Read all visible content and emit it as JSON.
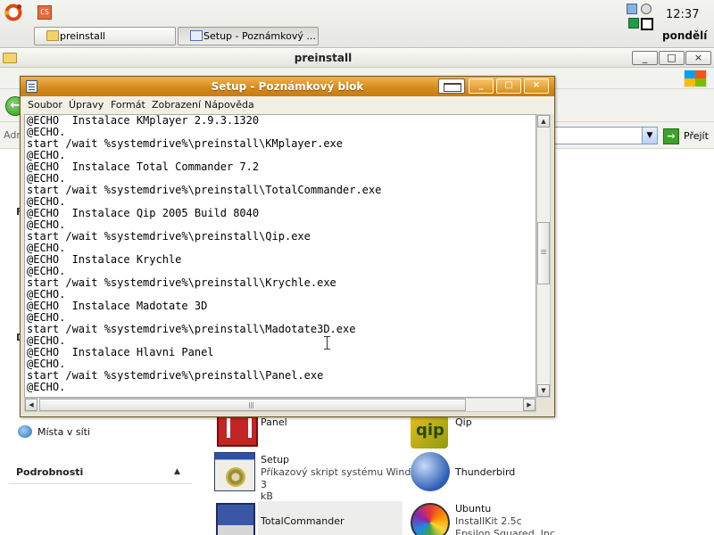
{
  "top_panel": {
    "tasks": [
      {
        "label": "preinstall"
      },
      {
        "label": "Setup - Poznámkový ..."
      }
    ],
    "clock": {
      "time": "12:37",
      "day": "pondělí"
    },
    "launcher_text": "CS"
  },
  "explorer": {
    "title": "preinstall",
    "window_buttons": {
      "minimize": "_",
      "maximize": "□",
      "close": "×"
    },
    "address_label": "Adr",
    "go_label": "Přejít",
    "sidebar": {
      "other_places_link": "Místa v síti",
      "details_header": "Podrobnosti",
      "collapse_arrow": "▲",
      "stub_letters": [
        "F",
        "D"
      ]
    },
    "files": [
      {
        "name": "Panel",
        "sub": "",
        "size": ""
      },
      {
        "name": "Qip",
        "sub": "",
        "size": ""
      },
      {
        "name": "Setup",
        "sub": "Příkazový skript systému Wind...",
        "size": "3 kB"
      },
      {
        "name": "Thunderbird",
        "sub": "",
        "size": ""
      },
      {
        "name": "TotalCommander",
        "sub": "",
        "size": ""
      },
      {
        "name": "Ubuntu",
        "sub": "InstallKit 2.5c",
        "size": "Epsilon Squared, Inc."
      }
    ]
  },
  "notepad": {
    "title": "Setup - Poznámkový blok",
    "window_buttons": {
      "minimize": "_",
      "maximize": "□",
      "close": "×"
    },
    "menu": [
      "Soubor",
      "Úpravy",
      "Formát",
      "Zobrazení",
      "Nápověda"
    ],
    "lines": [
      "@ECHO  Instalace KMplayer 2.9.3.1320",
      "@ECHO.",
      "start /wait %systemdrive%\\preinstall\\KMplayer.exe",
      "@ECHO.",
      "@ECHO  Instalace Total Commander 7.2",
      "@ECHO.",
      "start /wait %systemdrive%\\preinstall\\TotalCommander.exe",
      "@ECHO.",
      "@ECHO  Instalace Qip 2005 Build 8040",
      "@ECHO.",
      "start /wait %systemdrive%\\preinstall\\Qip.exe",
      "@ECHO.",
      "@ECHO  Instalace Krychle",
      "@ECHO.",
      "start /wait %systemdrive%\\preinstall\\Krychle.exe",
      "@ECHO.",
      "@ECHO  Instalace Madotate 3D",
      "@ECHO.",
      "start /wait %systemdrive%\\preinstall\\Madotate3D.exe",
      "@ECHO.",
      "@ECHO  Instalace Hlavni Panel",
      "@ECHO.",
      "start /wait %systemdrive%\\preinstall\\Panel.exe",
      "@ECHO."
    ],
    "scroll": {
      "up": "▲",
      "down": "▼",
      "left": "◀",
      "right": "▶"
    }
  },
  "colors": {
    "notepad_title": "#d58a1a",
    "selection_bg": "#ededeb",
    "panel_bg": "#e6e6e2"
  },
  "icons": {
    "ubuntu": "ubuntu-logo-icon",
    "folder": "folder-icon",
    "notepad": "notepad-icon",
    "back": "back-arrow-icon",
    "go": "go-arrow-icon",
    "network": "network-places-icon"
  }
}
